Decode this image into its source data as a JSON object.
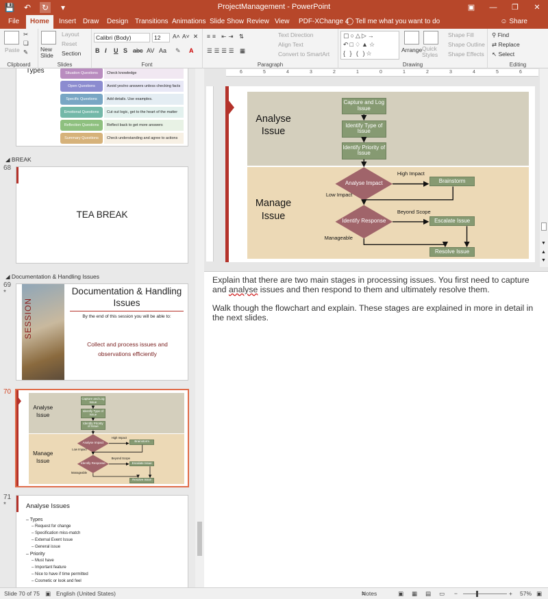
{
  "window": {
    "title": "ProjectManagement - PowerPoint",
    "controls": [
      "ribbon-options-icon",
      "minimize-icon",
      "restore-icon",
      "close-icon"
    ]
  },
  "qat": [
    "save-icon",
    "undo-icon",
    "redo-icon",
    "customize-icon"
  ],
  "tabs": [
    {
      "label": "File"
    },
    {
      "label": "Home"
    },
    {
      "label": "Insert"
    },
    {
      "label": "Draw"
    },
    {
      "label": "Design"
    },
    {
      "label": "Transitions"
    },
    {
      "label": "Animations"
    },
    {
      "label": "Slide Show"
    },
    {
      "label": "Review"
    },
    {
      "label": "View"
    },
    {
      "label": "PDF-XChange 4"
    }
  ],
  "active_tab": "Home",
  "tell_me": "Tell me what you want to do",
  "share": "Share",
  "ribbon": {
    "clipboard": {
      "label": "Clipboard",
      "paste": "Paste"
    },
    "slides": {
      "label": "Slides",
      "new_slide": "New Slide",
      "layout": "Layout",
      "reset": "Reset",
      "section": "Section"
    },
    "font": {
      "label": "Font",
      "family": "Calibri (Body)",
      "size": "12"
    },
    "paragraph": {
      "label": "Paragraph",
      "text_direction": "Text Direction",
      "align_text": "Align Text",
      "convert_smartart": "Convert to SmartArt"
    },
    "drawing": {
      "label": "Drawing",
      "arrange": "Arrange",
      "quick_styles": "Quick Styles",
      "shape_fill": "Shape Fill",
      "shape_outline": "Shape Outline",
      "shape_effects": "Shape Effects"
    },
    "editing": {
      "label": "Editing",
      "find": "Find",
      "replace": "Replace",
      "select": "Select"
    }
  },
  "thumbnails": {
    "slide66_rows": [
      {
        "label": "Situation Questions",
        "text": "Check knowledge",
        "color": "#b98cbf"
      },
      {
        "label": "Open Questions",
        "text": "Avoid yes/no answers unless checking facts",
        "color": "#8c8cd0"
      },
      {
        "label": "Specific Questions",
        "text": "Add details. Use examples.",
        "color": "#78a6c4"
      },
      {
        "label": "Emotional Questions",
        "text": "Cut out logic, get to the heart of the matter",
        "color": "#73b8a8"
      },
      {
        "label": "Reflection Questions",
        "text": "Reflect back to get more answers",
        "color": "#8ec07f"
      },
      {
        "label": "Summary Questions",
        "text": "Check understanding and agree to actions",
        "color": "#d6b27a"
      }
    ],
    "slide66_title": "Types",
    "section_break": "BREAK",
    "slide68": {
      "num": "68",
      "title": "TEA BREAK"
    },
    "section_doc": "Documentation & Handling Issues",
    "slide69": {
      "num": "69",
      "star": "*",
      "title": "Documentation & Handling Issues",
      "subtitle": "By the end of this session you will be able to:",
      "body": "Collect and process issues and observations efficiently",
      "side_text": "SESSION"
    },
    "slide70": {
      "num": "70"
    },
    "slide71": {
      "num": "71",
      "star": "*",
      "title": "Analyse Issues",
      "lines": [
        {
          "text": "Types",
          "level": 1
        },
        {
          "text": "Request for change",
          "level": 2
        },
        {
          "text": "Specification miss-match",
          "level": 2
        },
        {
          "text": "External Event Issue",
          "level": 2
        },
        {
          "text": "General issue",
          "level": 2
        },
        {
          "text": "Priority",
          "level": 1
        },
        {
          "text": "Must have",
          "level": 2
        },
        {
          "text": "Important feature",
          "level": 2
        },
        {
          "text": "Nice to have if time permitted",
          "level": 2
        },
        {
          "text": "Cosmetic or look and feel",
          "level": 2
        }
      ]
    }
  },
  "flowchart": {
    "band1_label": "Analyse Issue",
    "band2_label": "Manage Issue",
    "box_capture": "Capture and Log Issue",
    "box_type": "Identify Type of Issue",
    "box_priority": "Identify Priority of Issue",
    "dia_impact": "Analyse Impact",
    "dia_response": "Identify Response",
    "box_brainstorm": "Brainstorm",
    "box_escalate": "Escalate Issue",
    "box_resolve": "Resolve Issue",
    "lbl_high": "High Impact",
    "lbl_low": "Low Impact",
    "lbl_beyond": "Beyond Scope",
    "lbl_manageable": "Manageable"
  },
  "notes": {
    "p1_pre": "Explain that there are two main stages in processing issues. You first need to capture and ",
    "p1_squiggle": "analyse",
    "p1_post": " issues and then respond to them and ultimately resolve them.",
    "p2": "Walk though the flowchart and explain. These stages are explained in more in detail in the next slides."
  },
  "ruler_ticks": [
    "6",
    "5",
    "4",
    "3",
    "2",
    "1",
    "0",
    "1",
    "2",
    "3",
    "4",
    "5",
    "6"
  ],
  "status": {
    "slide_info": "Slide 70 of 75",
    "language": "English (United States)",
    "notes": "Notes",
    "zoom": "57%"
  }
}
